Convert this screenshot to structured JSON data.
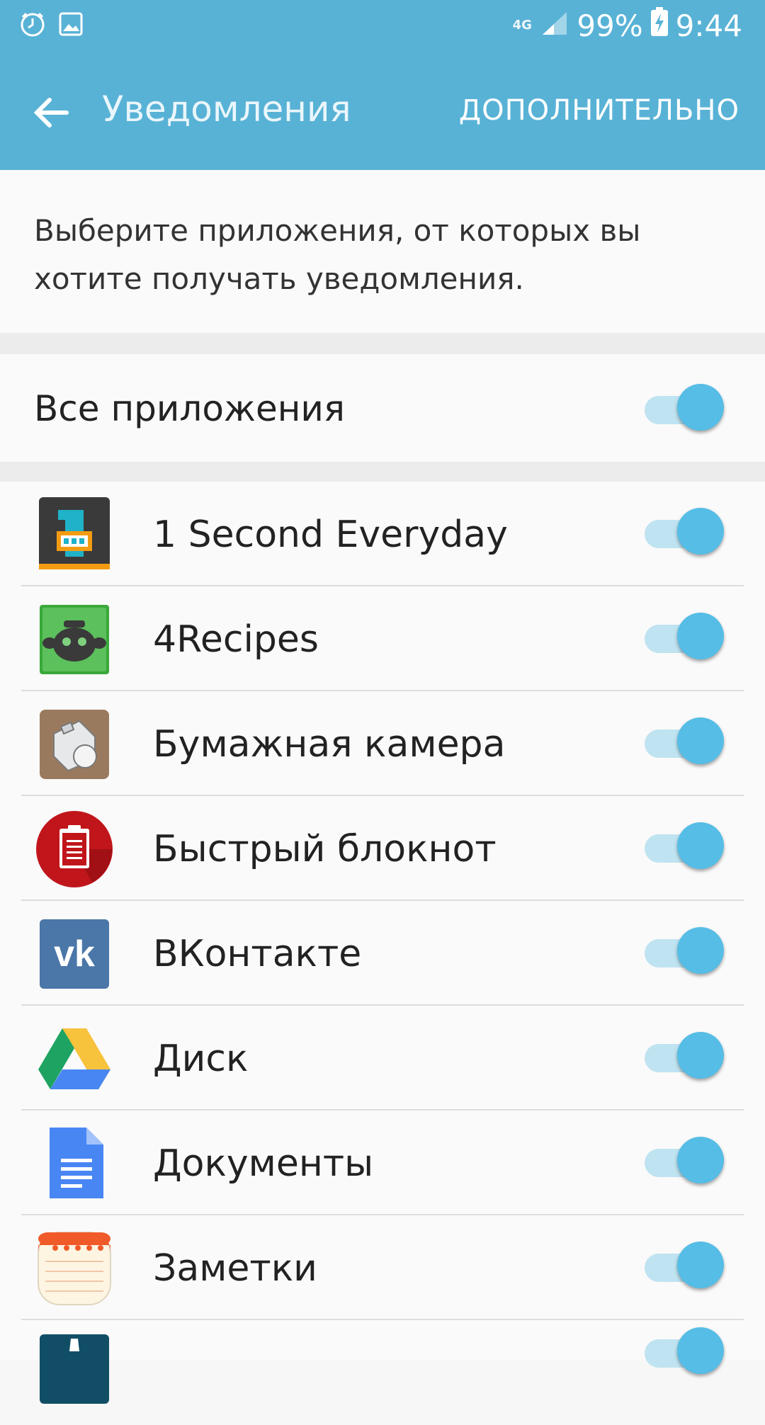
{
  "status_bar": {
    "network": "4G",
    "battery": "99%",
    "time": "9:44",
    "icons": [
      "alarm-icon",
      "gallery-icon",
      "signal-icon",
      "battery-charging-icon"
    ]
  },
  "app_bar": {
    "title": "Уведомления",
    "more_label": "ДОПОЛНИТЕЛЬНО",
    "back_icon": "arrow-left-icon",
    "background": "#58b2d6"
  },
  "description": "Выберите приложения, от которых вы хотите получать уведомления.",
  "all_apps": {
    "label": "Все приложения",
    "enabled": true
  },
  "apps": [
    {
      "name": "1 Second Everyday",
      "icon": "1se-icon",
      "enabled": true
    },
    {
      "name": "4Recipes",
      "icon": "recipes-pot-icon",
      "enabled": true
    },
    {
      "name": "Бумажная камера",
      "icon": "paper-camera-icon",
      "enabled": true
    },
    {
      "name": "Быстрый блокнот",
      "icon": "notepad-clipboard-icon",
      "enabled": true
    },
    {
      "name": "ВКонтакте",
      "icon": "vk-icon",
      "enabled": true
    },
    {
      "name": "Диск",
      "icon": "google-drive-icon",
      "enabled": true
    },
    {
      "name": "Документы",
      "icon": "google-docs-icon",
      "enabled": true
    },
    {
      "name": "Заметки",
      "icon": "notes-icon",
      "enabled": true
    }
  ],
  "colors": {
    "accent": "#55bde6",
    "track": "#bfe3f1"
  }
}
